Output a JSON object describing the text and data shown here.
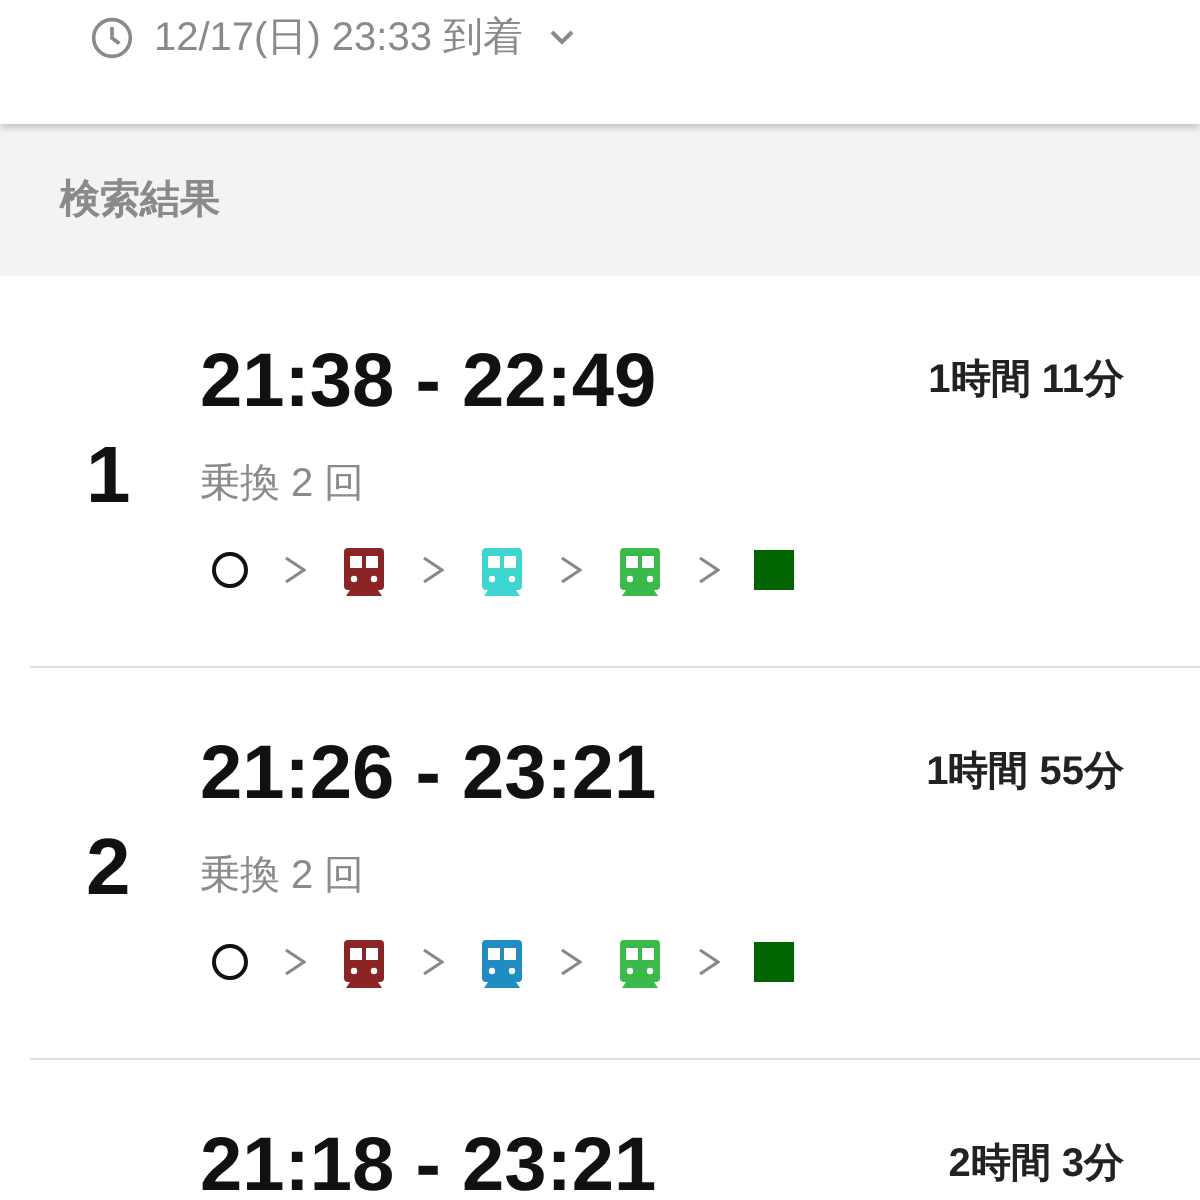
{
  "arrival": {
    "text": "12/17(日) 23:33 到着"
  },
  "section_title": "検索結果",
  "results": [
    {
      "number": "1",
      "time": "21:38 - 22:49",
      "duration": "1時間 11分",
      "transfers": "乗換 2 回",
      "route": [
        {
          "kind": "origin"
        },
        {
          "kind": "train",
          "color": "#8b2525"
        },
        {
          "kind": "train",
          "color": "#3dd6d0"
        },
        {
          "kind": "train",
          "color": "#3cb94b"
        },
        {
          "kind": "destination",
          "color": "#006400"
        }
      ]
    },
    {
      "number": "2",
      "time": "21:26 - 23:21",
      "duration": "1時間 55分",
      "transfers": "乗換 2 回",
      "route": [
        {
          "kind": "origin"
        },
        {
          "kind": "train",
          "color": "#8b2525"
        },
        {
          "kind": "train",
          "color": "#1f8cc4"
        },
        {
          "kind": "train",
          "color": "#3cb94b"
        },
        {
          "kind": "destination",
          "color": "#006400"
        }
      ]
    },
    {
      "time": "21:18 - 23:21",
      "duration": "2時間 3分"
    }
  ]
}
